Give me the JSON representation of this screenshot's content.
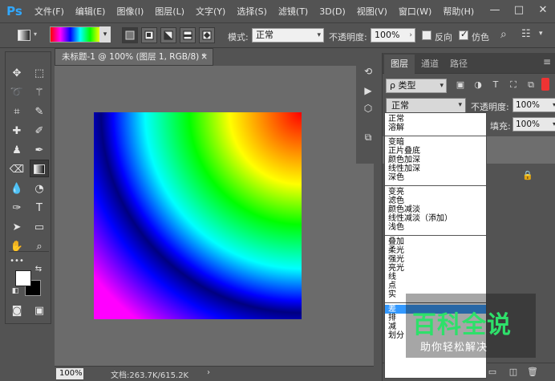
{
  "app": {
    "logo": "Ps"
  },
  "menu": [
    "文件(F)",
    "编辑(E)",
    "图像(I)",
    "图层(L)",
    "文字(Y)",
    "选择(S)",
    "滤镜(T)",
    "3D(D)",
    "视图(V)",
    "窗口(W)",
    "帮助(H)"
  ],
  "window_controls": {
    "minimize": "—",
    "maximize": "□",
    "close": "✕"
  },
  "options": {
    "mode_label": "模式:",
    "mode_value": "正常",
    "opacity_label": "不透明度:",
    "opacity_value": "100%",
    "reverse_label": "反向",
    "reverse_checked": false,
    "dither_label": "仿色",
    "dither_checked": true,
    "gradient_colors": [
      "#ff0000",
      "#ff00ff",
      "#0000ff",
      "#00ffff",
      "#00ff00",
      "#ffff00",
      "#ff0000"
    ]
  },
  "document": {
    "tab_title": "未标题-1 @ 100% (图层 1, RGB/8) *",
    "close": "×",
    "zoom": "100%",
    "doc_info": "文档:263.7K/615.2K",
    "info_arrow": "›"
  },
  "toolbox": {
    "more": "•••",
    "foreground_color": "#ffffff",
    "background_color": "#000000"
  },
  "layers_panel": {
    "tabs": [
      "图层",
      "通道",
      "路径"
    ],
    "kind_label": "ρ 类型",
    "blend_mode": "正常",
    "opacity_label": "不透明度:",
    "opacity_value": "100%",
    "fill_label": "填充:",
    "fill_value": "100%"
  },
  "blend_modes": {
    "groups": [
      [
        "正常",
        "溶解"
      ],
      [
        "变暗",
        "正片叠底",
        "颜色加深",
        "线性加深",
        "深色"
      ],
      [
        "变亮",
        "滤色",
        "颜色减淡",
        "线性减淡（添加）",
        "浅色"
      ],
      [
        "叠加",
        "柔光",
        "强光",
        "亮光",
        "线",
        "点",
        "实"
      ],
      [
        "差",
        "排",
        "减",
        "划分"
      ]
    ],
    "highlighted": "差"
  },
  "watermark": {
    "logo": "百科全说",
    "tagline": "助你轻松解决"
  }
}
